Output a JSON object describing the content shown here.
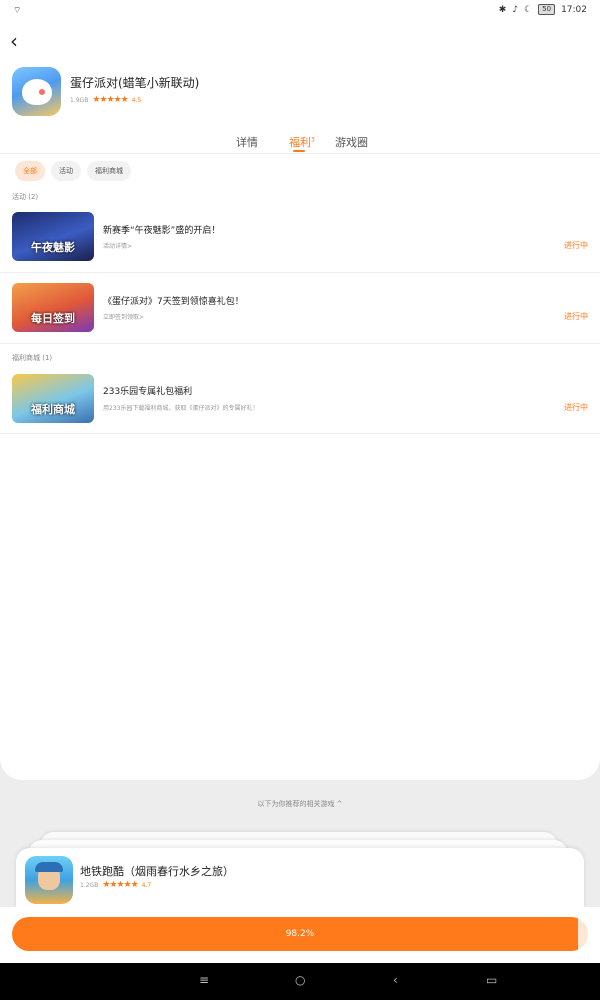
{
  "status_bar": {
    "time": "17:02",
    "battery": "50",
    "wifi_icon": "wifi-icon",
    "icons": [
      "bluetooth-icon",
      "mute-icon",
      "moon-icon"
    ]
  },
  "app": {
    "title": "蛋仔派对(蜡笔小新联动)",
    "size": "1.9GB",
    "stars": "★★★★★",
    "rating": "4.5"
  },
  "tabs": [
    {
      "label": "详情",
      "badge": ""
    },
    {
      "label": "福利",
      "badge": "3"
    },
    {
      "label": "游戏圈",
      "badge": ""
    }
  ],
  "filters": [
    "全部",
    "活动",
    "福利商城"
  ],
  "sections": {
    "activity_label": "活动 (2)",
    "mall_label": "福利商城 (1)"
  },
  "rows": [
    {
      "thumb_text": "午夜魅影",
      "title": "新赛季“午夜魅影”盛的开启！",
      "sub": "活动详情>",
      "status": "进行中"
    },
    {
      "thumb_text": "每日签到",
      "title": "《蛋仔派对》7天签到领惊喜礼包！",
      "sub": "立即签到领取>",
      "status": "进行中"
    },
    {
      "thumb_text": "福利商城",
      "title": "233乐园专属礼包福利",
      "sub": "用233乐园下载福利商城，获取《蛋仔派对》的专属好礼！",
      "status": "进行中"
    }
  ],
  "more_link": "以下为你推荐的相关游戏 ^",
  "recommend": {
    "title": "地铁跑酷（烟雨春行水乡之旅）",
    "size": "1.2GB",
    "stars": "★★★★★",
    "rating": "4.7"
  },
  "download": {
    "progress_label": "98.2%",
    "progress": 0.982
  },
  "colors": {
    "accent": "#ff7a1a",
    "accent_light": "#ffe7d3"
  },
  "navbar": {
    "menu": "≡",
    "home": "○",
    "back": "‹",
    "recent": "▭"
  }
}
